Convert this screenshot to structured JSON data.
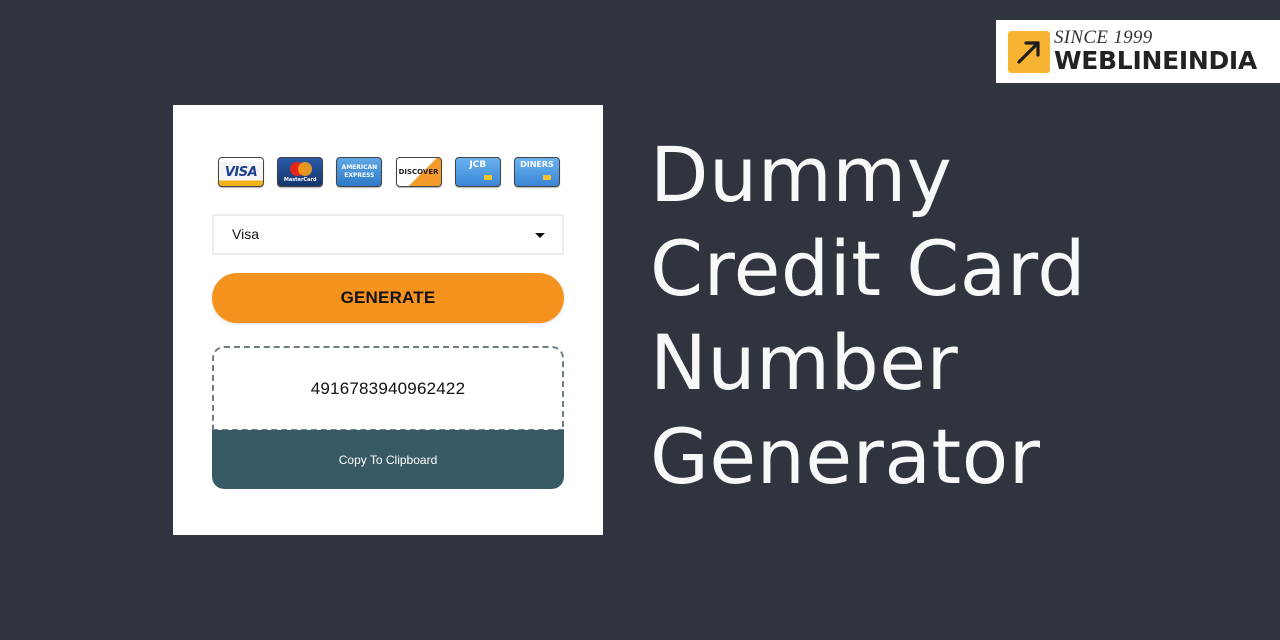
{
  "logo": {
    "since": "SINCE 1999",
    "name": "WEBLINEINDIA",
    "icon": "arrow-up-right-icon",
    "accent": "#f9b332"
  },
  "generator": {
    "brands": [
      {
        "name": "VISA",
        "icon": "visa-card-icon"
      },
      {
        "name": "MasterCard",
        "icon": "mastercard-card-icon"
      },
      {
        "name": "AMERICAN EXPRESS",
        "icon": "amex-card-icon"
      },
      {
        "name": "DISCOVER",
        "icon": "discover-card-icon"
      },
      {
        "name": "JCB",
        "icon": "jcb-card-icon"
      },
      {
        "name": "DINERS",
        "icon": "diners-card-icon"
      }
    ],
    "select": {
      "value": "Visa",
      "icon": "caret-down-icon"
    },
    "generate_label": "GENERATE",
    "result_number": "4916783940962422",
    "copy_label": "Copy To Clipboard",
    "colors": {
      "generate": "#f6921e",
      "copy": "#385a64"
    }
  },
  "headline": {
    "lines": [
      "Dummy",
      "Credit Card",
      "Number",
      "Generator"
    ]
  },
  "colors": {
    "background": "#2f343f",
    "headline": "#f7f8f8"
  }
}
